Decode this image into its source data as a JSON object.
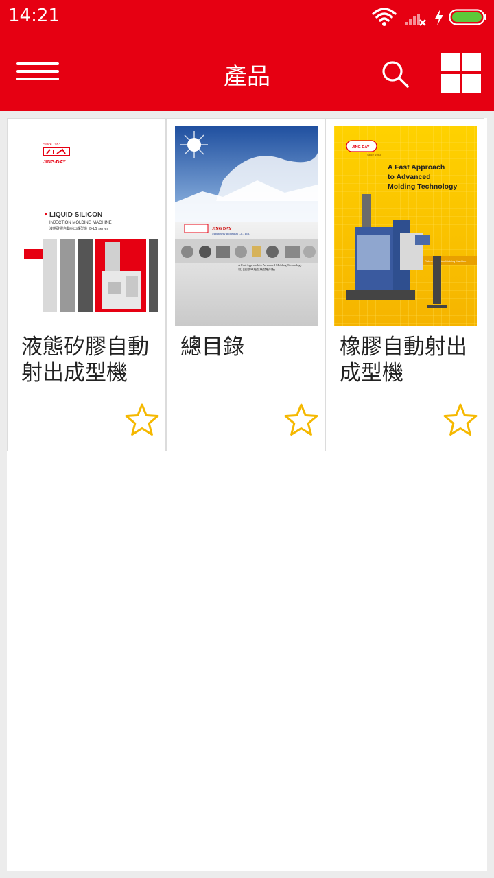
{
  "status_bar": {
    "time": "14:21",
    "icons": [
      "wifi-icon",
      "signal-no-service-icon",
      "charging-icon",
      "battery-icon"
    ]
  },
  "app_bar": {
    "title": "產品",
    "icons": [
      "menu-icon",
      "search-icon",
      "grid-view-icon"
    ]
  },
  "colors": {
    "brand_red": "#e60012",
    "star_yellow": "#f5b800"
  },
  "products": [
    {
      "title": "液態矽膠自動射出成型機",
      "cover": {
        "since": "Since 1983",
        "brand": "JING-DAY",
        "heading": "LIQUID SILICON",
        "subheading": "INJECTION MOLDING MACHINE",
        "line3": "液態矽膠自動射出成型機 JD-LS series"
      }
    },
    {
      "title": "總目錄",
      "cover": {
        "brand": "JING DAY",
        "company": "Machinery Industrial Co., Ltd.",
        "tagline": "A Fast Approach to Advanced Molding Technology",
        "tagline_zh": "就乃迎接卓越發展發展科技"
      }
    },
    {
      "title": "橡膠自動射出成型機",
      "cover": {
        "brand": "JING DAY",
        "since": "Since 1983",
        "headline": "A Fast Approach to Advanced Molding Technology",
        "band": "Rubber Injection Molding Machine"
      }
    }
  ]
}
